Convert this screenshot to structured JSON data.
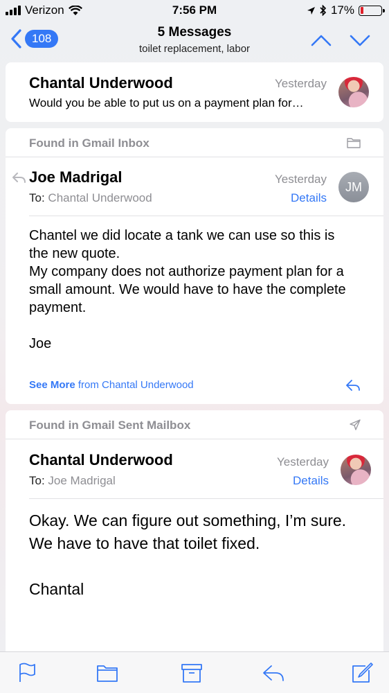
{
  "status_bar": {
    "carrier": "Verizon",
    "time": "7:56 PM",
    "battery": "17%",
    "battery_level": 0.17
  },
  "nav": {
    "unread_count": "108",
    "title": "5 Messages",
    "subtitle": "toilet replacement, labor"
  },
  "messages": [
    {
      "sender": "Chantal Underwood",
      "date": "Yesterday",
      "preview": "Would you be able to put us on a payment plan for…"
    },
    {
      "found_in": "Found in Gmail Inbox",
      "sender": "Joe Madrigal",
      "to_label": "To:",
      "to": "Chantal Underwood",
      "date": "Yesterday",
      "details": "Details",
      "avatar_initials": "JM",
      "body": "Chantel we did locate a tank we can use so this is\nthe new quote.\nMy company does not authorize payment plan for a\nsmall amount.  We would have to have the complete\npayment.\n\nJoe",
      "see_more": "See More",
      "see_more_from": "from Chantal Underwood"
    },
    {
      "found_in": "Found in Gmail Sent Mailbox",
      "sender": "Chantal Underwood",
      "to_label": "To:",
      "to": "Joe Madrigal",
      "date": "Yesterday",
      "details": "Details",
      "body": "Okay. We can figure out something, I’m sure.\nWe have to have that toilet fixed.\n\nChantal"
    }
  ],
  "toolbar": {
    "icons": [
      "flag-icon",
      "folder-icon",
      "archive-icon",
      "reply-icon",
      "compose-icon"
    ]
  },
  "colors": {
    "accent": "#3478f6",
    "secondary_text": "#8e8e93",
    "battery_low": "#e0202a"
  }
}
